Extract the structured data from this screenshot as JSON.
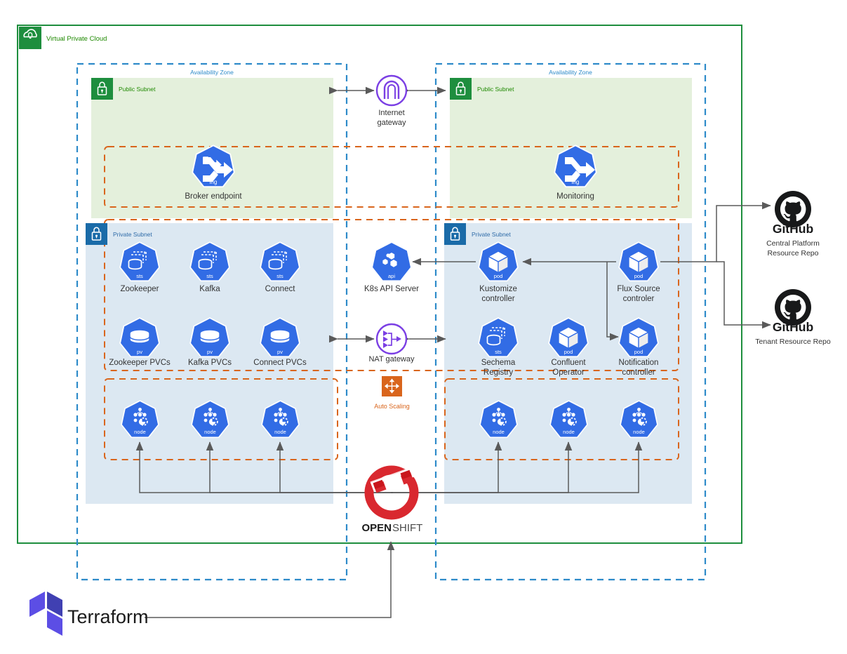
{
  "diagram": {
    "title": "Virtual Private Cloud",
    "colors": {
      "vpc_green": "#1E8E3E",
      "vpc_label_green": "#1E8900",
      "public_subnet_fill": "#E4F0DC",
      "public_subnet_badge": "#1E8E3E",
      "private_subnet_fill": "#DCE8F2",
      "private_subnet_badge": "#1A6BA8",
      "az_dashed_blue": "#2E8BC9",
      "group_dashed_orange": "#D9651C",
      "k8s_blue": "#326CE5",
      "gateway_purple": "#7B3FE4",
      "autoscaling_orange": "#D9651C",
      "openshift_red": "#D9282F",
      "terraform_purple": "#5C4EE5",
      "arrow_gray": "#5A5A5A",
      "github_black": "#18191A"
    }
  },
  "vpc": {
    "label": "Virtual Private Cloud",
    "icon": "cloud-lock-icon"
  },
  "availability_zones": [
    {
      "label": "Availability Zone",
      "side": "left"
    },
    {
      "label": "Availability Zone",
      "side": "right"
    }
  ],
  "subnets": {
    "public_left": {
      "label": "Public Subnet",
      "icon": "lock-icon"
    },
    "public_right": {
      "label": "Public Subnet",
      "icon": "lock-icon"
    },
    "private_left": {
      "label": "Private Subnet",
      "icon": "lock-icon"
    },
    "private_right": {
      "label": "Private Subnet",
      "icon": "lock-icon"
    }
  },
  "nodes": {
    "broker_endpoint": {
      "label": "Broker endpoint",
      "badge": "ing",
      "icon": "k8s-ingress-icon"
    },
    "monitoring": {
      "label": "Monitoring",
      "badge": "ing",
      "icon": "k8s-ingress-icon"
    },
    "zookeeper": {
      "label": "Zookeeper",
      "badge": "sts",
      "icon": "k8s-statefulset-icon"
    },
    "kafka": {
      "label": "Kafka",
      "badge": "sts",
      "icon": "k8s-statefulset-icon"
    },
    "connect": {
      "label": "Connect",
      "badge": "sts",
      "icon": "k8s-statefulset-icon"
    },
    "zookeeper_pvcs": {
      "label": "Zookeeper PVCs",
      "badge": "pv",
      "icon": "k8s-persistentvolume-icon"
    },
    "kafka_pvcs": {
      "label": "Kafka PVCs",
      "badge": "pv",
      "icon": "k8s-persistentvolume-icon"
    },
    "connect_pvcs": {
      "label": "Connect PVCs",
      "badge": "pv",
      "icon": "k8s-persistentvolume-icon"
    },
    "k8s_api_server": {
      "label": "K8s API Server",
      "badge": "api",
      "icon": "k8s-apiserver-icon"
    },
    "kustomize_controller": {
      "label_line1": "Kustomize",
      "label_line2": "controller",
      "badge": "pod",
      "icon": "k8s-pod-icon"
    },
    "flux_source_controller": {
      "label_line1": "Flux Source",
      "label_line2": "controler",
      "badge": "pod",
      "icon": "k8s-pod-icon"
    },
    "schema_registry": {
      "label_line1": "Sechema",
      "label_line2": "Registry",
      "badge": "sts",
      "icon": "k8s-statefulset-icon"
    },
    "confluent_operator": {
      "label_line1": "Confluent",
      "label_line2": "Operator",
      "badge": "pod",
      "icon": "k8s-pod-icon"
    },
    "notification_controller": {
      "label_line1": "Notification",
      "label_line2": "controller",
      "badge": "pod",
      "icon": "k8s-pod-icon"
    },
    "worker_nodes": {
      "label": "node",
      "badge": "node",
      "icon": "k8s-node-icon",
      "count_left": 3,
      "count_right": 3
    }
  },
  "gateways": {
    "internet_gateway": {
      "label_line1": "Internet",
      "label_line2": "gateway",
      "icon": "internet-gateway-icon"
    },
    "nat_gateway": {
      "label": "NAT gateway",
      "icon": "nat-gateway-icon"
    }
  },
  "auto_scaling": {
    "label": "Auto Scaling",
    "icon": "auto-scaling-icon"
  },
  "external": {
    "github_central": {
      "logo_text": "GitHub",
      "label_line1": "Central Platform",
      "label_line2": "Resource Repo",
      "icon": "github-icon"
    },
    "github_tenant": {
      "logo_text": "GitHub",
      "label": "Tenant Resource Repo",
      "icon": "github-icon"
    },
    "openshift": {
      "text_bold": "OPEN",
      "text_light": "SHIFT",
      "icon": "openshift-logo-icon"
    },
    "terraform": {
      "label": "Terraform",
      "icon": "terraform-logo-icon"
    }
  }
}
